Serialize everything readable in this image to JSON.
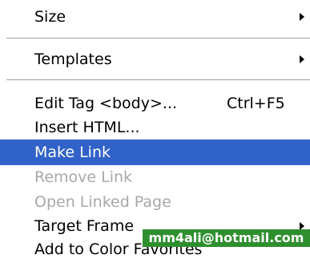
{
  "menu": {
    "items": [
      {
        "label": "Size",
        "submenu": true
      },
      {
        "label": "Templates",
        "submenu": true
      },
      {
        "label": "Edit Tag <body>...",
        "shortcut": "Ctrl+F5"
      },
      {
        "label": "Insert HTML..."
      },
      {
        "label": "Make Link",
        "state": "highlighted"
      },
      {
        "label": "Remove Link",
        "state": "disabled"
      },
      {
        "label": "Open Linked Page",
        "state": "disabled"
      },
      {
        "label": "Target Frame",
        "submenu": true
      },
      {
        "label": "Add to Color Favorites"
      }
    ]
  },
  "watermark": {
    "text": "mm4ali@hotmail.com"
  },
  "colors": {
    "highlight": "#3162c9",
    "highlight_text": "#ffffff",
    "disabled_text": "#a8a8a8",
    "watermark_bg": "#2f8f2f"
  },
  "icons": {
    "submenu_arrow": "chevron-right-icon"
  }
}
